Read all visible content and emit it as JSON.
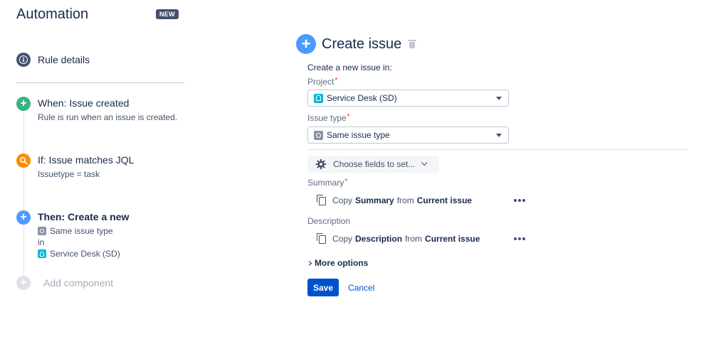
{
  "header": {
    "title": "Automation",
    "badge": "NEW"
  },
  "sidebar": {
    "rule_details": "Rule details",
    "steps": [
      {
        "title": "When: Issue created",
        "desc": "Rule is run when an issue is created.",
        "icon": "plus-icon",
        "color": "#36B37E"
      },
      {
        "title": "If: Issue matches JQL",
        "desc": "Issuetype = task",
        "icon": "search-icon",
        "color": "#FF8B00"
      },
      {
        "title": "Then: Create a new",
        "issue_type": "Same issue type",
        "connector": "in",
        "project": "Service Desk (SD)",
        "icon": "plus-icon",
        "color": "#4C9AFF"
      }
    ],
    "add_component": "Add component"
  },
  "main": {
    "title": "Create issue",
    "intro": "Create a new issue in:",
    "project_label": "Project",
    "project_value": "Service Desk (SD)",
    "issue_type_label": "Issue type",
    "issue_type_value": "Same issue type",
    "required_mark": "*",
    "choose_fields": "Choose fields to set...",
    "summary_label": "Summary",
    "summary_copy": {
      "prefix": "Copy",
      "field": "Summary",
      "mid": "from",
      "source": "Current issue"
    },
    "description_label": "Description",
    "description_copy": {
      "prefix": "Copy",
      "field": "Description",
      "mid": "from",
      "source": "Current issue"
    },
    "more_options": "More options",
    "save": "Save",
    "cancel": "Cancel"
  },
  "colors": {
    "primary": "#0052CC",
    "required": "#DE350B",
    "text": "#172B4D"
  }
}
